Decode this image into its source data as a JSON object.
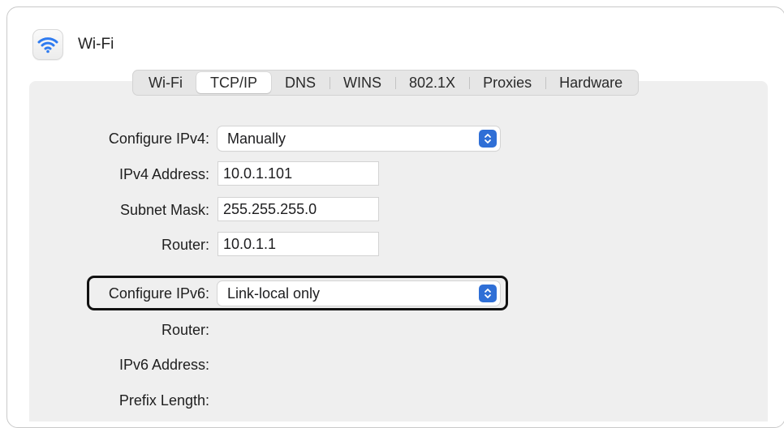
{
  "window": {
    "title": "Wi-Fi",
    "icon": "wifi-icon"
  },
  "tabs": [
    {
      "label": "Wi-Fi",
      "active": false
    },
    {
      "label": "TCP/IP",
      "active": true
    },
    {
      "label": "DNS",
      "active": false
    },
    {
      "label": "WINS",
      "active": false
    },
    {
      "label": "802.1X",
      "active": false
    },
    {
      "label": "Proxies",
      "active": false
    },
    {
      "label": "Hardware",
      "active": false
    }
  ],
  "ipv4": {
    "configure_label": "Configure IPv4:",
    "configure_value": "Manually",
    "address_label": "IPv4 Address:",
    "address_value": "10.0.1.101",
    "subnet_label": "Subnet Mask:",
    "subnet_value": "255.255.255.0",
    "router_label": "Router:",
    "router_value": "10.0.1.1"
  },
  "ipv6": {
    "configure_label": "Configure IPv6:",
    "configure_value": "Link-local only",
    "router_label": "Router:",
    "address_label": "IPv6 Address:",
    "prefix_label": "Prefix Length:"
  },
  "colors": {
    "accent": "#2f6fd6",
    "highlight_border": "#111111"
  }
}
